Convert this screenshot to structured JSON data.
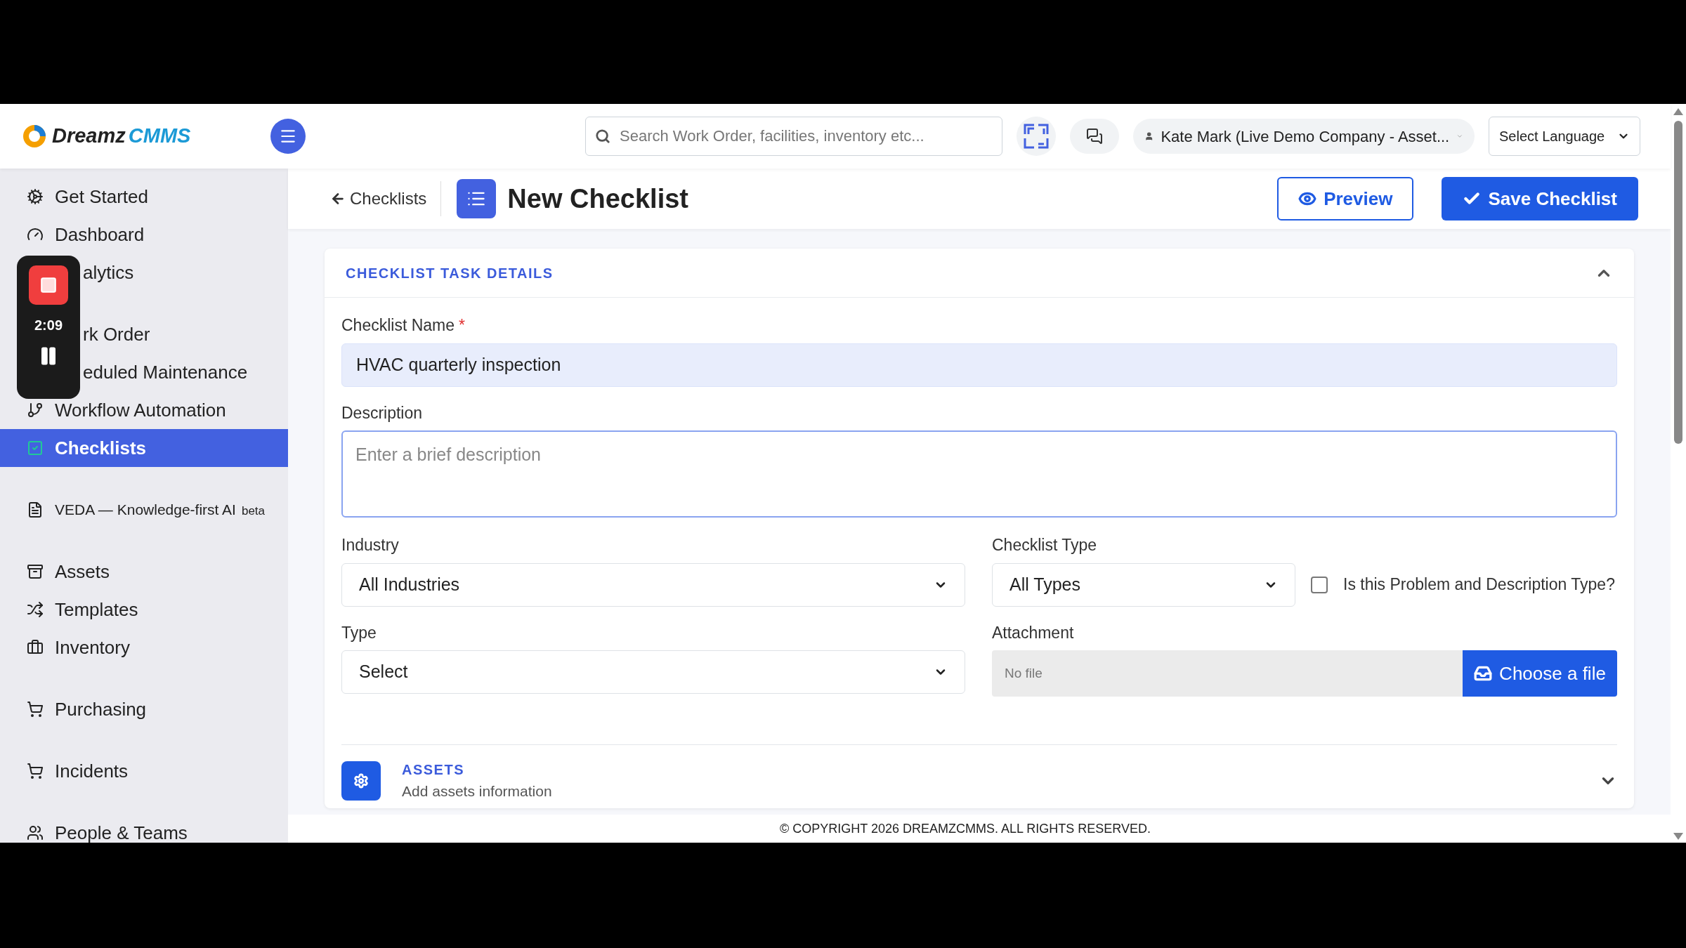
{
  "logo": {
    "word_1": "Dreamz",
    "word_2": "CMMS"
  },
  "search": {
    "placeholder": "Search Work Order, facilities, inventory etc..."
  },
  "user": {
    "name": "Kate Mark (Live Demo Company - Asset..."
  },
  "language_select": {
    "value": "Select Language"
  },
  "recorder": {
    "time": "2:09"
  },
  "sidebar": {
    "items": [
      {
        "label": "Get Started",
        "kind": "item",
        "selected": false
      },
      {
        "label": "Dashboard",
        "kind": "item",
        "selected": false
      },
      {
        "label": "alytics",
        "kind": "covered",
        "selected": false
      },
      {
        "label": "rk Order",
        "kind": "covered",
        "selected": false
      },
      {
        "label": "eduled Maintenance",
        "kind": "covered",
        "selected": false
      },
      {
        "label": "Workflow Automation",
        "kind": "item",
        "selected": false
      },
      {
        "label": "Checklists",
        "kind": "item",
        "selected": true
      },
      {
        "label": "VEDA — Knowledge-first AI",
        "badge": "beta",
        "kind": "item",
        "selected": false
      },
      {
        "label": "Assets",
        "kind": "item",
        "selected": false
      },
      {
        "label": "Templates",
        "kind": "item",
        "selected": false
      },
      {
        "label": "Inventory",
        "kind": "item",
        "selected": false
      },
      {
        "label": "Purchasing",
        "kind": "item",
        "selected": false
      },
      {
        "label": "Incidents",
        "kind": "item",
        "selected": false
      },
      {
        "label": "People & Teams",
        "kind": "item",
        "selected": false
      }
    ]
  },
  "breadcrumb": {
    "back_link": "Checklists"
  },
  "page_title": "New Checklist",
  "required_mark": "*",
  "buttons": [
    {
      "label": "Preview",
      "kind": "outline"
    },
    {
      "label": "Save Checklist",
      "kind": "primary"
    }
  ],
  "details_section": {
    "title": "CHECKLIST TASK DETAILS",
    "expanded": true,
    "name_field": {
      "label": "Checklist Name",
      "required": true,
      "value": "HVAC quarterly inspection"
    },
    "description_field": {
      "label": "Description",
      "placeholder": "Enter a brief description"
    },
    "industry_select": {
      "label": "Industry",
      "value": "All Industries"
    },
    "checklist_type_select": {
      "label": "Checklist Type",
      "value": "All Types"
    },
    "problem_checkbox": {
      "label": "Is this Problem and Description Type?",
      "checked": false
    },
    "type_select": {
      "label": "Type",
      "value": "Select"
    },
    "attachment": {
      "label": "Attachment",
      "value": "No file",
      "button": "Choose a file"
    }
  },
  "assets_section": {
    "title": "ASSETS",
    "subtitle": "Add assets information",
    "expanded": false
  },
  "footer": "© COPYRIGHT 2026 DREAMZCMMS. ALL RIGHTS RESERVED."
}
